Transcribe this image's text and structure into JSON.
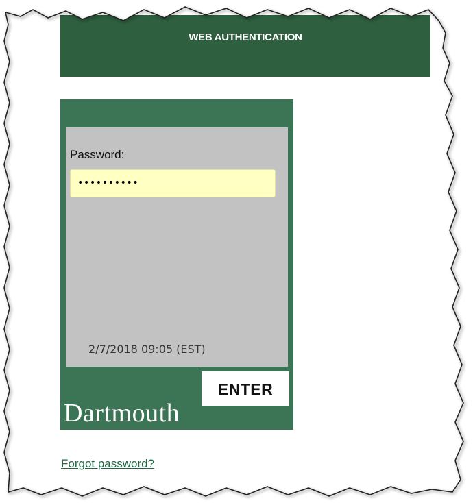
{
  "header": {
    "title": "WEB AUTHENTICATION"
  },
  "login": {
    "password_label": "Password:",
    "password_value": "••••••••••",
    "timestamp": "2/7/2018 09:05 (EST)",
    "enter_label": "ENTER",
    "wordmark": "Dartmouth"
  },
  "footer": {
    "forgot_link": "Forgot password?"
  },
  "colors": {
    "header_green": "#2e5f3e",
    "box_green": "#3c7456",
    "panel_gray": "#c2c2c2",
    "input_yellow": "#ffffc4",
    "link_green": "#1f6a44"
  }
}
